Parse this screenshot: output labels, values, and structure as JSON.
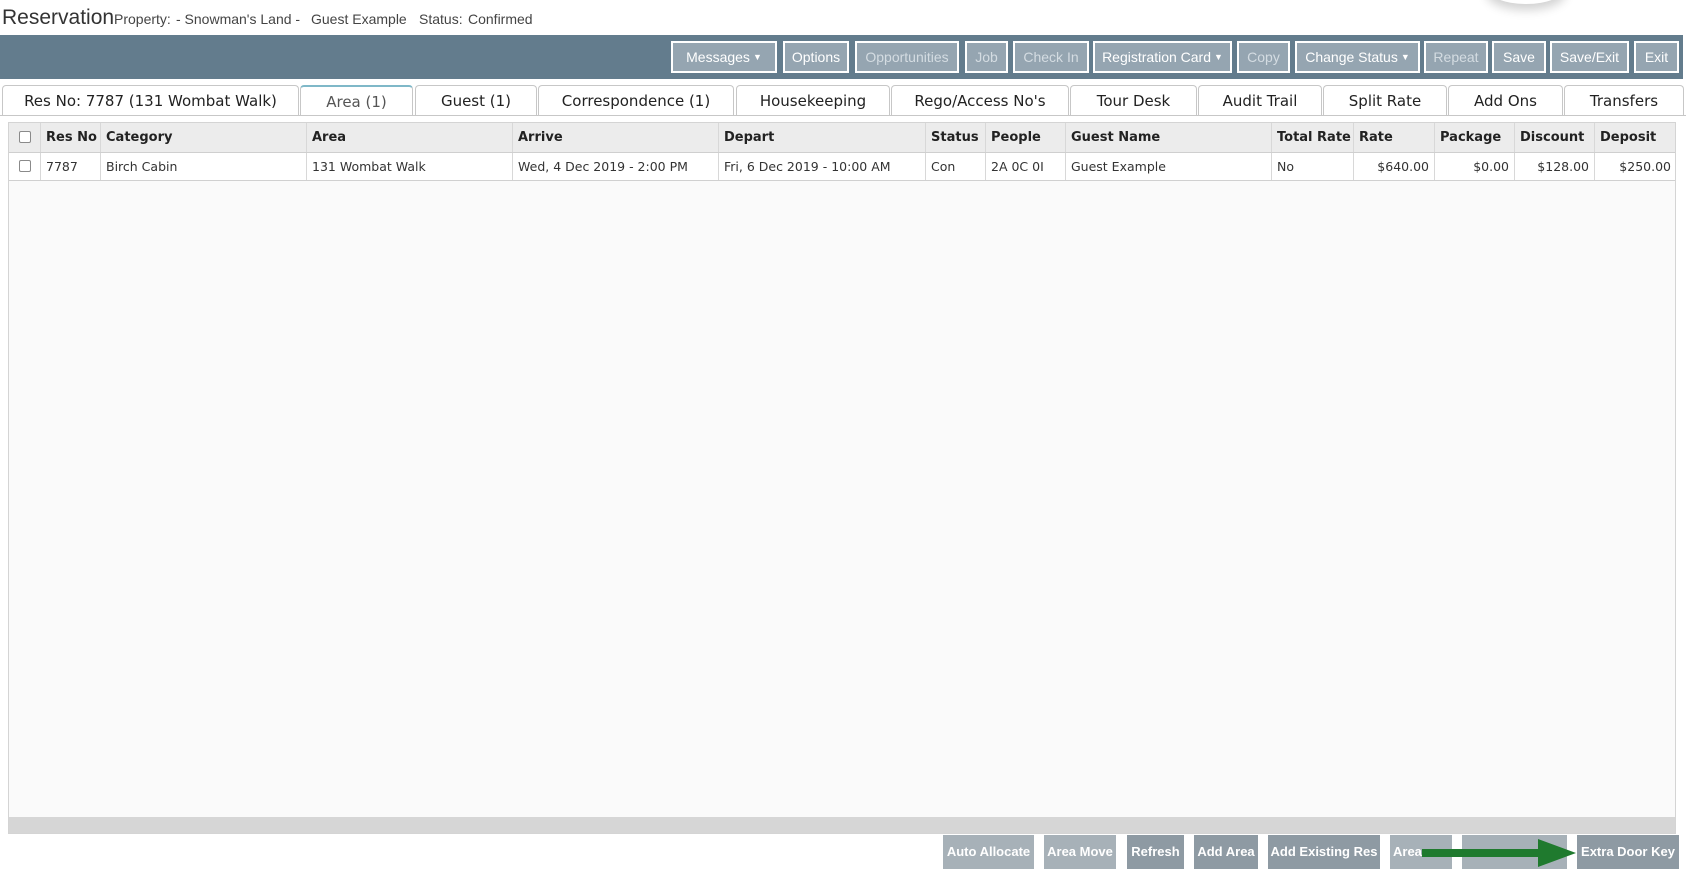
{
  "window": {
    "title": "Reservation",
    "property_label": "Property:",
    "property_value": "- Snowman's Land -",
    "guest": "Guest Example",
    "status_label": "Status:",
    "status_value": "Confirmed"
  },
  "toolbar": {
    "messages": "Messages",
    "options": "Options",
    "opportunities": "Opportunities",
    "job": "Job",
    "check_in": "Check In",
    "registration_card": "Registration Card",
    "copy": "Copy",
    "change_status": "Change Status",
    "repeat": "Repeat",
    "save": "Save",
    "save_exit": "Save/Exit",
    "exit": "Exit"
  },
  "tabs": [
    {
      "label": "Res No: 7787 (131 Wombat Walk)"
    },
    {
      "label": "Area (1)",
      "active": true
    },
    {
      "label": "Guest (1)"
    },
    {
      "label": "Correspondence (1)"
    },
    {
      "label": "Housekeeping"
    },
    {
      "label": "Rego/Access No's"
    },
    {
      "label": "Tour Desk"
    },
    {
      "label": "Audit Trail"
    },
    {
      "label": "Split Rate"
    },
    {
      "label": "Add Ons"
    },
    {
      "label": "Transfers"
    }
  ],
  "grid": {
    "columns": [
      "Res No",
      "Category",
      "Area",
      "Arrive",
      "Depart",
      "Status",
      "People",
      "Guest Name",
      "Total Rate",
      "Rate",
      "Package",
      "Discount",
      "Deposit"
    ],
    "rows": [
      {
        "res_no": "7787",
        "category": "Birch Cabin",
        "area": "131 Wombat Walk",
        "arrive": "Wed, 4 Dec 2019 - 2:00 PM",
        "depart": "Fri, 6 Dec 2019 - 10:00 AM",
        "status": "Con",
        "people": "2A 0C 0I",
        "guest_name": "Guest Example",
        "total_rate": "No",
        "rate": "$640.00",
        "package": "$0.00",
        "discount": "$128.00",
        "deposit": "$250.00"
      }
    ]
  },
  "bottom_buttons": {
    "auto_allocate": "Auto Allocate",
    "area_move": "Area Move",
    "refresh": "Refresh",
    "add_area": "Add Area",
    "add_existing_res": "Add Existing Res",
    "area_partial": "Area",
    "extra_door_key": "Extra Door Key"
  },
  "colors": {
    "toolbar_bg": "#637c8d",
    "toolbar_button": "#95a5b1",
    "annotation_arrow": "#1f7a2e"
  }
}
